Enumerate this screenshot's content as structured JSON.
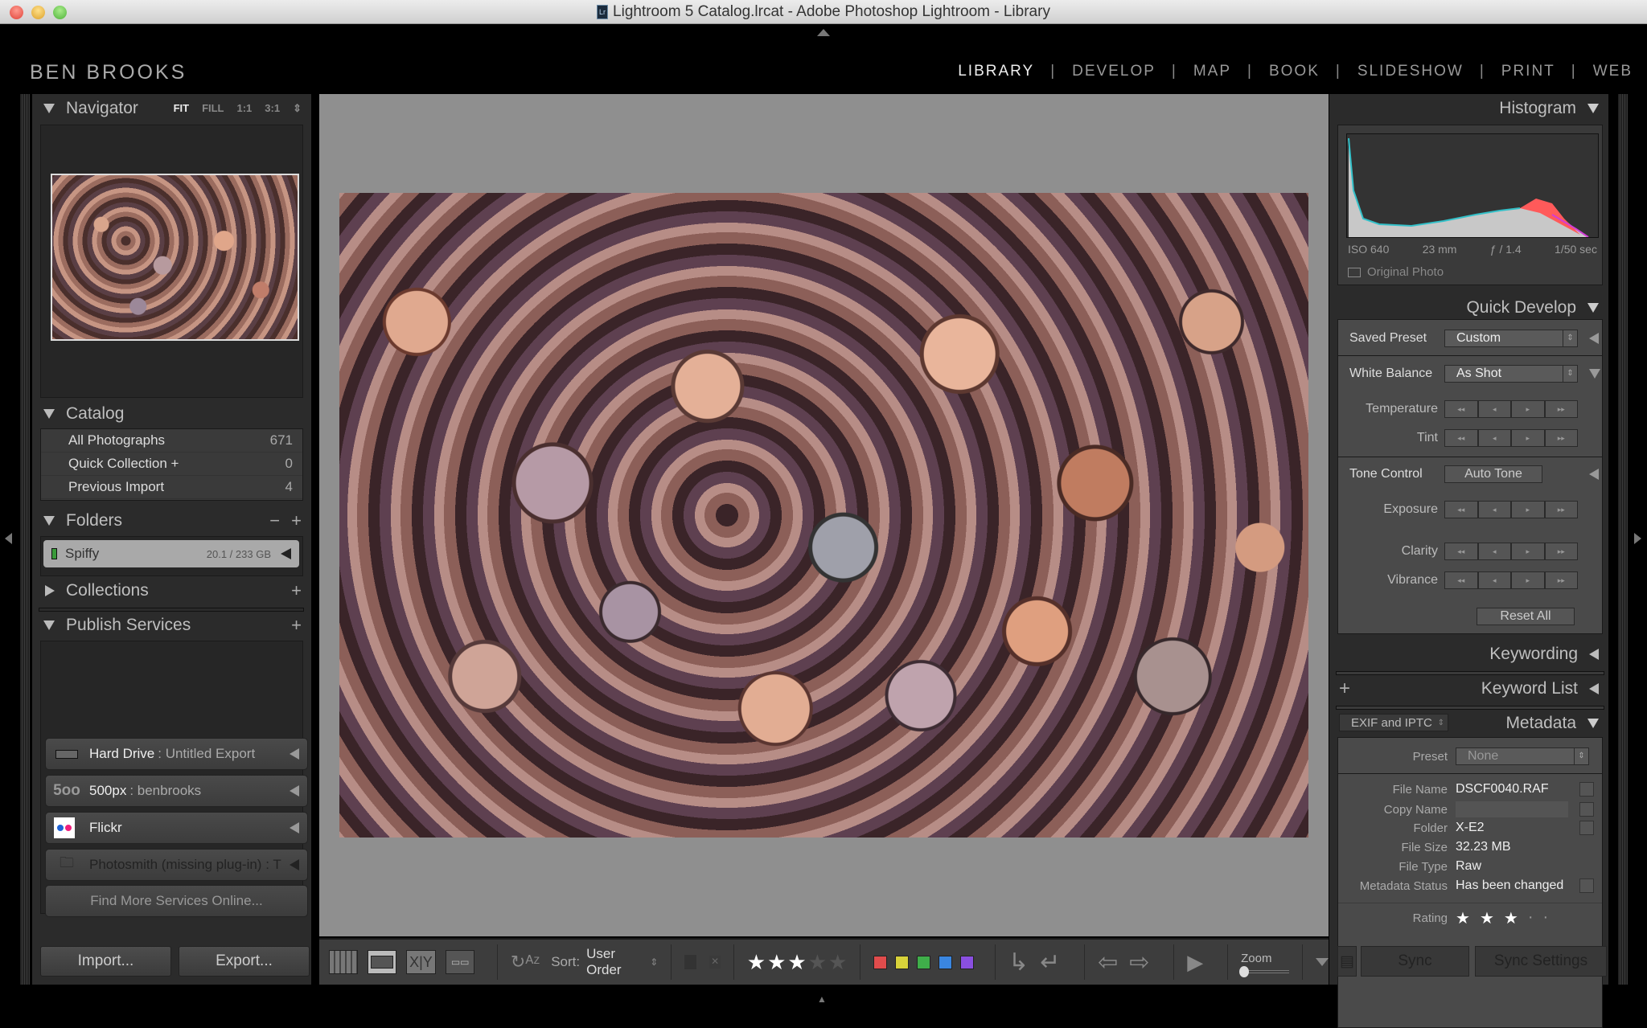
{
  "window": {
    "title": "Lightroom 5 Catalog.lrcat - Adobe Photoshop Lightroom - Library",
    "app_icon": "Lr"
  },
  "identity_plate": "BEN BROOKS",
  "modules": [
    "LIBRARY",
    "DEVELOP",
    "MAP",
    "BOOK",
    "SLIDESHOW",
    "PRINT",
    "WEB"
  ],
  "active_module": "LIBRARY",
  "left": {
    "navigator": {
      "title": "Navigator",
      "zoom_options": [
        "FIT",
        "FILL",
        "1:1",
        "3:1"
      ],
      "selected_zoom": "FIT"
    },
    "catalog": {
      "title": "Catalog",
      "items": [
        {
          "label": "All Photographs",
          "count": "671"
        },
        {
          "label": "Quick Collection +",
          "count": "0"
        },
        {
          "label": "Previous Import",
          "count": "4"
        }
      ]
    },
    "folders": {
      "title": "Folders",
      "minus": "−",
      "plus": "+",
      "volume": {
        "name": "Spiffy",
        "size": "20.1 / 233 GB"
      }
    },
    "collections": {
      "title": "Collections",
      "plus": "+"
    },
    "publish": {
      "title": "Publish Services",
      "plus": "+",
      "services": [
        {
          "name": "Hard Drive",
          "sub": ": Untitled Export",
          "icon": "hard-drive-icon"
        },
        {
          "name": "500px",
          "sub": ": benbrooks",
          "icon": "500px-icon",
          "icon_text": "5oo"
        },
        {
          "name": "Flickr",
          "sub": "",
          "icon": "flickr-icon"
        },
        {
          "name": "Photosmith (missing plug-in) : T",
          "sub": "",
          "icon": "missing-folder-icon"
        }
      ],
      "find_more": "Find More Services Online..."
    },
    "import_label": "Import...",
    "export_label": "Export..."
  },
  "toolbar": {
    "sort_label": "Sort:",
    "sort_value": "User Order",
    "rating": 3,
    "rating_max": 5,
    "color_labels": [
      "#e04c4c",
      "#d8d23a",
      "#3fae4a",
      "#3a86e0",
      "#8a4fe0"
    ],
    "zoom_label": "Zoom"
  },
  "right": {
    "histogram": {
      "title": "Histogram",
      "iso": "ISO 640",
      "focal": "23 mm",
      "aperture": "ƒ / 1.4",
      "shutter": "1/50 sec",
      "original_photo": "Original Photo"
    },
    "quick_develop": {
      "title": "Quick Develop",
      "saved_preset_label": "Saved Preset",
      "saved_preset_value": "Custom",
      "white_balance_label": "White Balance",
      "white_balance_value": "As Shot",
      "temperature": "Temperature",
      "tint": "Tint",
      "tone_control_label": "Tone Control",
      "auto_tone": "Auto Tone",
      "exposure": "Exposure",
      "clarity": "Clarity",
      "vibrance": "Vibrance",
      "reset_all": "Reset All",
      "stepper_glyphs": [
        "◂◂",
        "◂",
        "▸",
        "▸▸"
      ]
    },
    "keywording": "Keywording",
    "keyword_list": "Keyword List",
    "keyword_plus": "+",
    "metadata": {
      "title": "Metadata",
      "view": "EXIF and IPTC",
      "preset_label": "Preset",
      "preset_value": "None",
      "fields": [
        {
          "key": "File Name",
          "value": "DSCF0040.RAF"
        },
        {
          "key": "Copy Name",
          "value": ""
        },
        {
          "key": "Folder",
          "value": "X-E2"
        },
        {
          "key": "File Size",
          "value": "32.23 MB"
        },
        {
          "key": "File Type",
          "value": "Raw"
        },
        {
          "key": "Metadata Status",
          "value": "Has been changed"
        }
      ],
      "rating_label": "Rating",
      "rating": 3
    },
    "sync_label": "Sync",
    "sync_settings_label": "Sync Settings"
  }
}
